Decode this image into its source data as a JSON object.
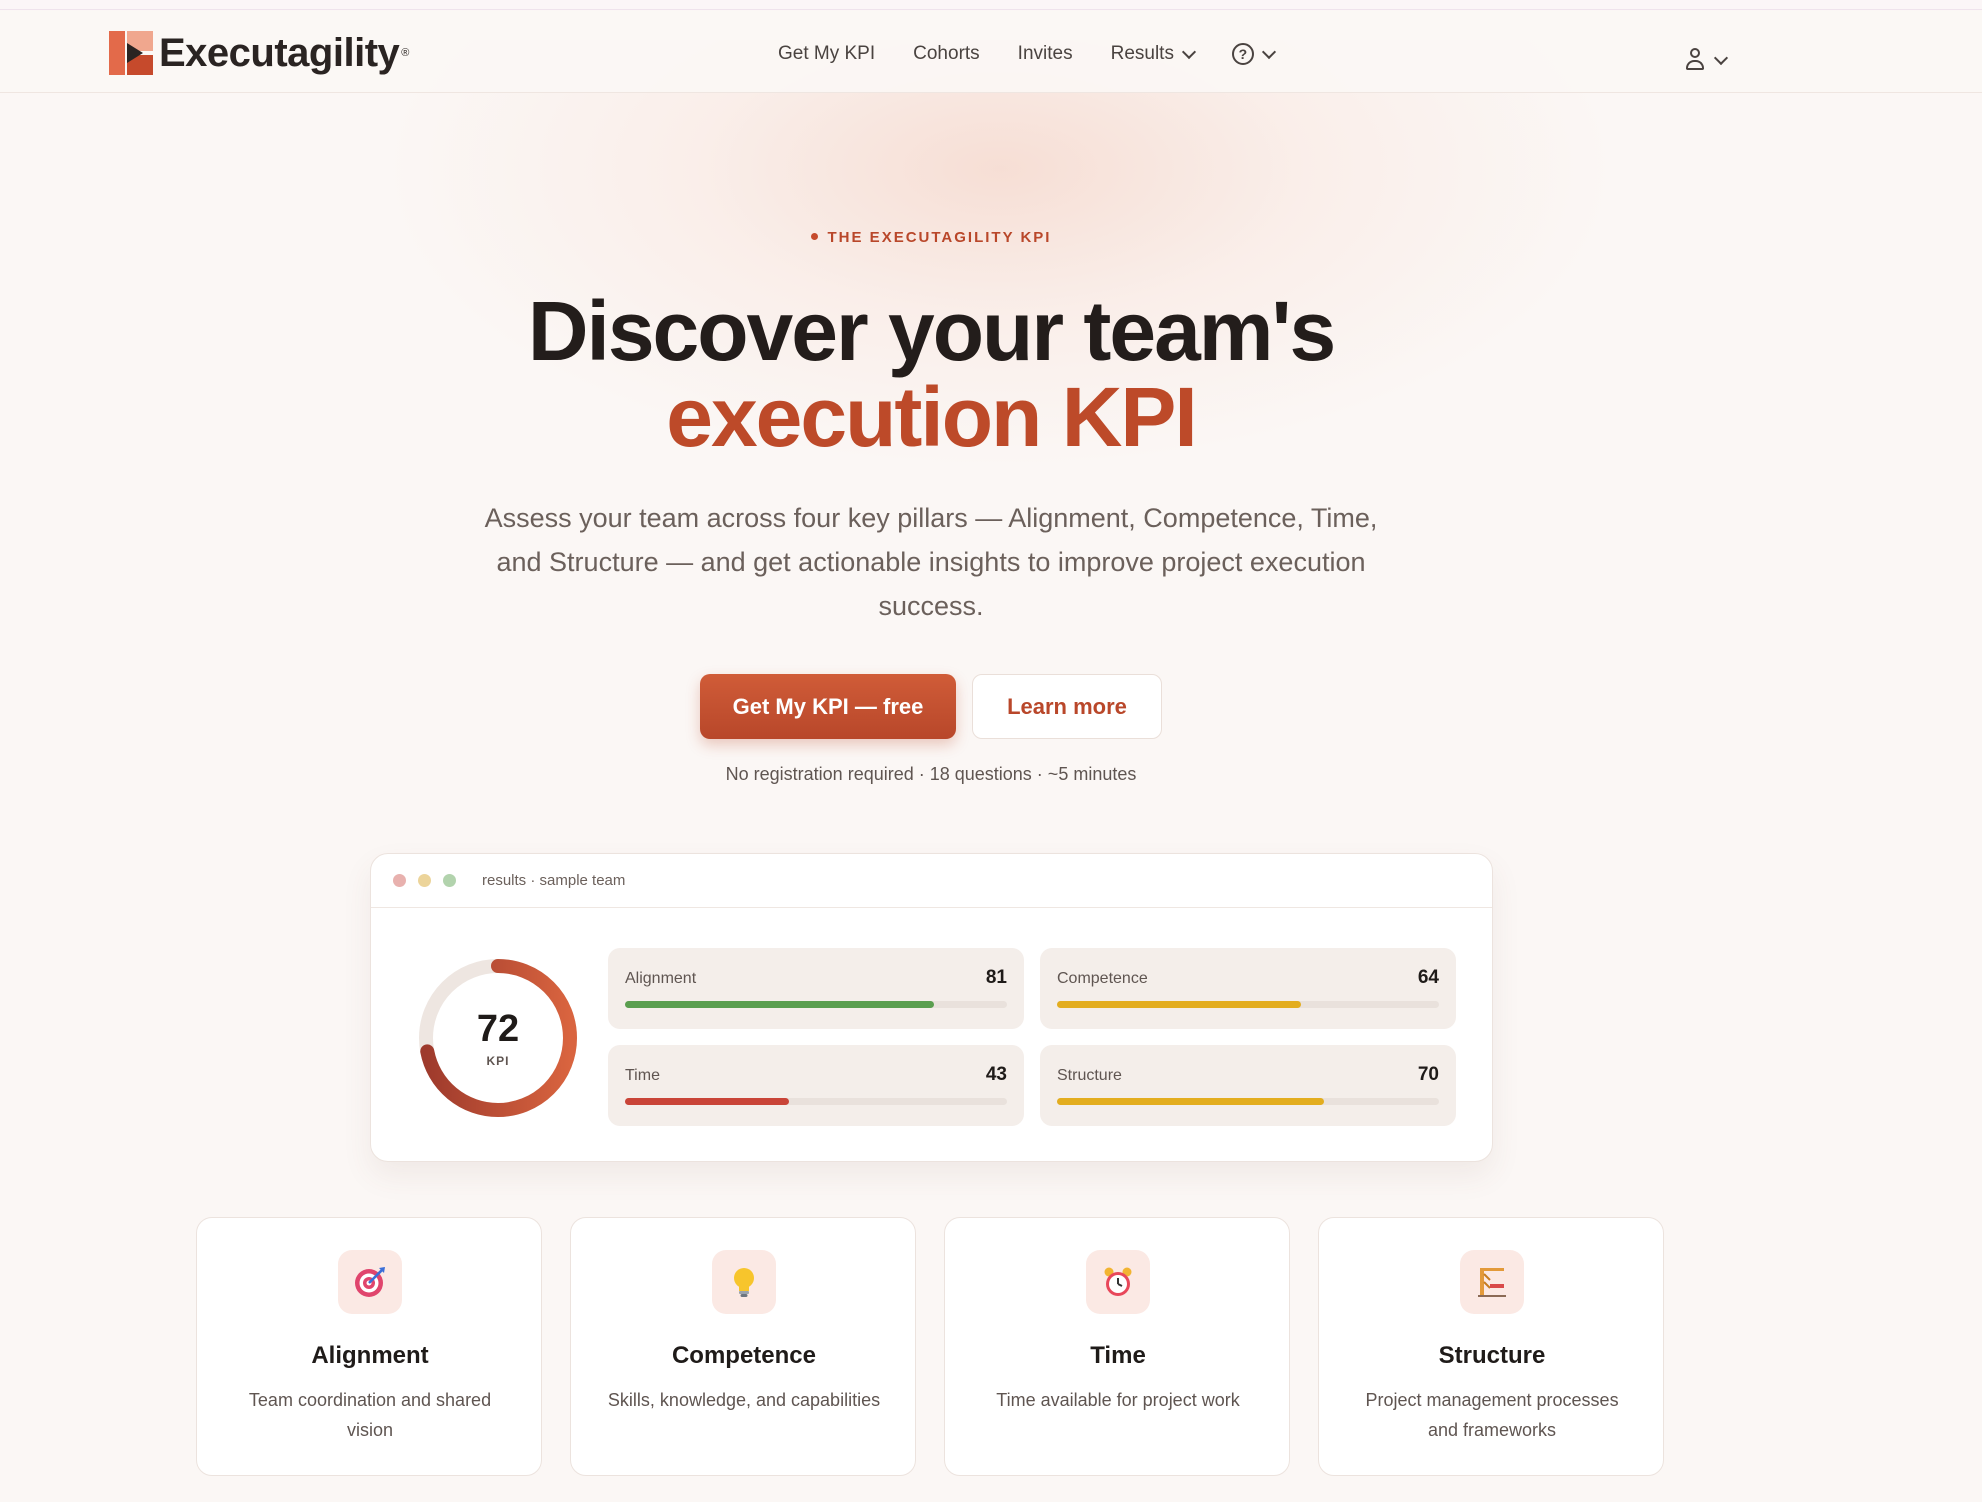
{
  "brand": {
    "name": "Executagility",
    "reg": "®"
  },
  "nav": {
    "items": [
      "Get My KPI",
      "Cohorts",
      "Invites",
      "Results"
    ],
    "help_glyph": "?"
  },
  "hero": {
    "eyebrow": "THE EXECUTAGILITY KPI",
    "title_line1": "Discover your team's",
    "title_line2": "execution KPI",
    "lede": "Assess your team across four key pillars — Alignment, Competence, Time, and Structure — and get actionable insights to improve project execution success.",
    "cta_primary": "Get My KPI — free",
    "cta_secondary": "Learn more",
    "note": "No registration required · 18 questions · ~5 minutes"
  },
  "results": {
    "title": "results · sample team",
    "kpi": {
      "value": "72",
      "label": "KPI",
      "fraction": 0.72
    },
    "metrics": [
      {
        "name": "Alignment",
        "value": "81",
        "fraction": 0.81,
        "color": "#5a9e4f"
      },
      {
        "name": "Competence",
        "value": "64",
        "fraction": 0.64,
        "color": "#e3ad1f"
      },
      {
        "name": "Time",
        "value": "43",
        "fraction": 0.43,
        "color": "#c94438"
      },
      {
        "name": "Structure",
        "value": "70",
        "fraction": 0.7,
        "color": "#e3ad1f"
      }
    ]
  },
  "pillars": [
    {
      "title": "Alignment",
      "desc": "Team coordination and shared vision",
      "icon": "target-icon"
    },
    {
      "title": "Competence",
      "desc": "Skills, knowledge, and capabilities",
      "icon": "lightbulb-icon"
    },
    {
      "title": "Time",
      "desc": "Time available for project work",
      "icon": "alarm-clock-icon"
    },
    {
      "title": "Structure",
      "desc": "Project management processes and frameworks",
      "icon": "building-structure-icon"
    }
  ],
  "colors": {
    "accent": "#bd4a29",
    "background": "#fbf7f5"
  }
}
